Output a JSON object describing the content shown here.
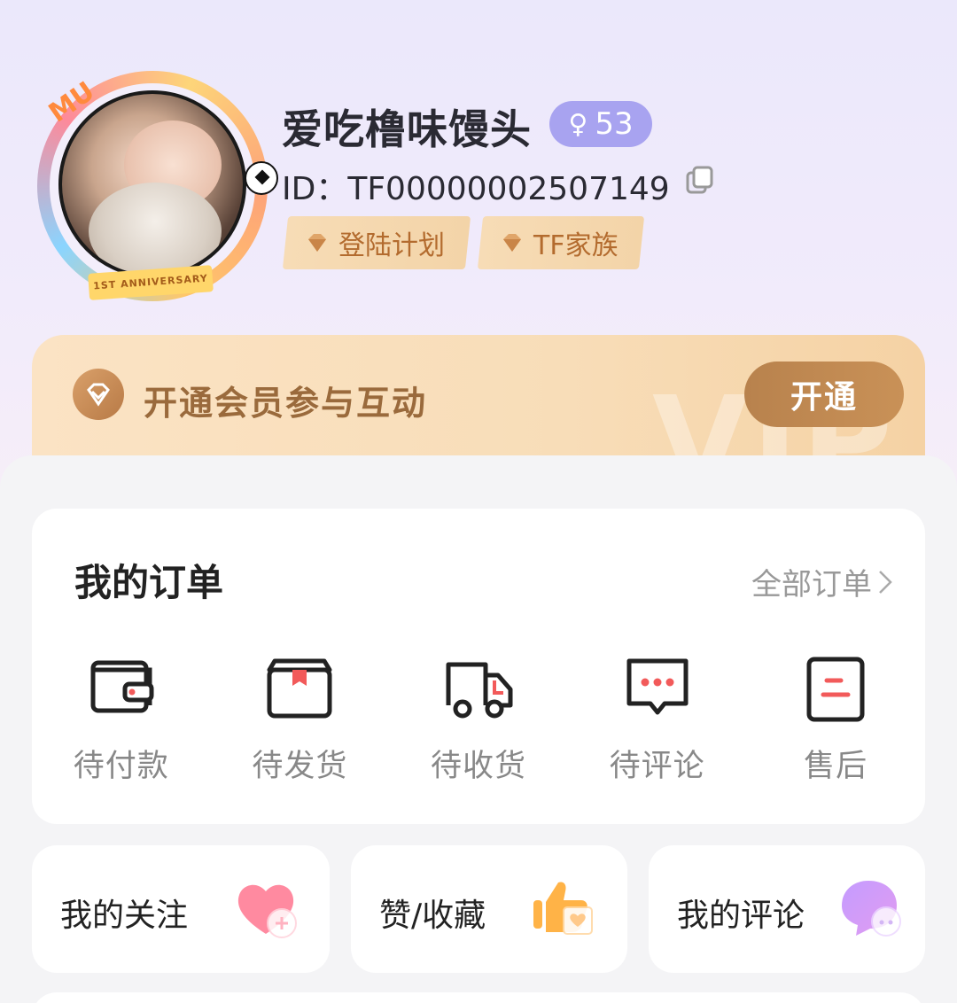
{
  "profile": {
    "username": "爱吃橹味馒头",
    "level": "53",
    "level_gender_icon": "female-icon",
    "id_text": "ID：TF00000002507149",
    "avatar_banner": "1ST ANNIVERSARY",
    "avatar_frame_text": "MU",
    "tags": [
      {
        "label": "登陆计划",
        "icon": "gem-icon"
      },
      {
        "label": "TF家族",
        "icon": "gem-icon"
      }
    ]
  },
  "vip": {
    "text": "开通会员参与互动",
    "button": "开通",
    "watermark": "VIP"
  },
  "orders": {
    "title": "我的订单",
    "all_link": "全部订单",
    "items": [
      {
        "label": "待付款",
        "icon": "wallet-icon"
      },
      {
        "label": "待发货",
        "icon": "box-icon"
      },
      {
        "label": "待收货",
        "icon": "truck-icon"
      },
      {
        "label": "待评论",
        "icon": "comment-icon"
      },
      {
        "label": "售后",
        "icon": "after-sales-icon"
      }
    ]
  },
  "quick": [
    {
      "label": "我的关注",
      "icon": "heart-icon"
    },
    {
      "label": "赞/收藏",
      "icon": "thumbs-up-icon"
    },
    {
      "label": "我的评论",
      "icon": "speech-bubble-icon"
    }
  ],
  "colors": {
    "accent_purple": "#a8a3f0",
    "tag_text": "#b36b2e",
    "vip_button": "#b8824d",
    "order_icon_red": "#f25a5a"
  }
}
